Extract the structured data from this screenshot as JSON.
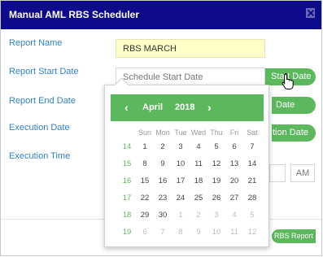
{
  "dialog": {
    "title": "Manual AML RBS Scheduler",
    "labels": {
      "report_name": "Report Name",
      "report_start_date": "Report Start Date",
      "report_end_date": "Report End Date",
      "execution_date": "Execution Date",
      "execution_time": "Execution Time"
    },
    "report_name_value": "RBS MARCH",
    "start_date_placeholder": "Schedule Start Date",
    "start_date_button": "Start Date",
    "end_date_button": "Date",
    "execution_date_button": "tion Date",
    "ampm": "AM",
    "rbs_report_button": "RBS Report",
    "colors": {
      "title_bar": "#0e0a8c",
      "accent": "#5cb85c",
      "label": "#2f82c8"
    }
  },
  "datepicker": {
    "month": "April",
    "year": "2018",
    "prev_icon": "‹",
    "next_icon": "›",
    "weekdays": [
      "Sun",
      "Mon",
      "Tue",
      "Wed",
      "Thu",
      "Fri",
      "Sat"
    ],
    "weeks": [
      {
        "week": "14",
        "days": [
          "1",
          "2",
          "3",
          "4",
          "5",
          "6",
          "7"
        ]
      },
      {
        "week": "15",
        "days": [
          "8",
          "9",
          "10",
          "11",
          "12",
          "13",
          "14"
        ]
      },
      {
        "week": "16",
        "days": [
          "15",
          "16",
          "17",
          "18",
          "19",
          "20",
          "21"
        ]
      },
      {
        "week": "17",
        "days": [
          "22",
          "23",
          "24",
          "25",
          "26",
          "27",
          "28"
        ]
      },
      {
        "week": "18",
        "days": [
          "29",
          "30",
          "1",
          "2",
          "3",
          "4",
          "5"
        ]
      },
      {
        "week": "19",
        "days": [
          "6",
          "7",
          "8",
          "9",
          "10",
          "11",
          "12"
        ]
      }
    ],
    "outside_month": [
      [
        4,
        2
      ],
      [
        4,
        3
      ],
      [
        4,
        4
      ],
      [
        4,
        5
      ],
      [
        4,
        6
      ],
      [
        5,
        0
      ],
      [
        5,
        1
      ],
      [
        5,
        2
      ],
      [
        5,
        3
      ],
      [
        5,
        4
      ],
      [
        5,
        5
      ],
      [
        5,
        6
      ]
    ]
  }
}
